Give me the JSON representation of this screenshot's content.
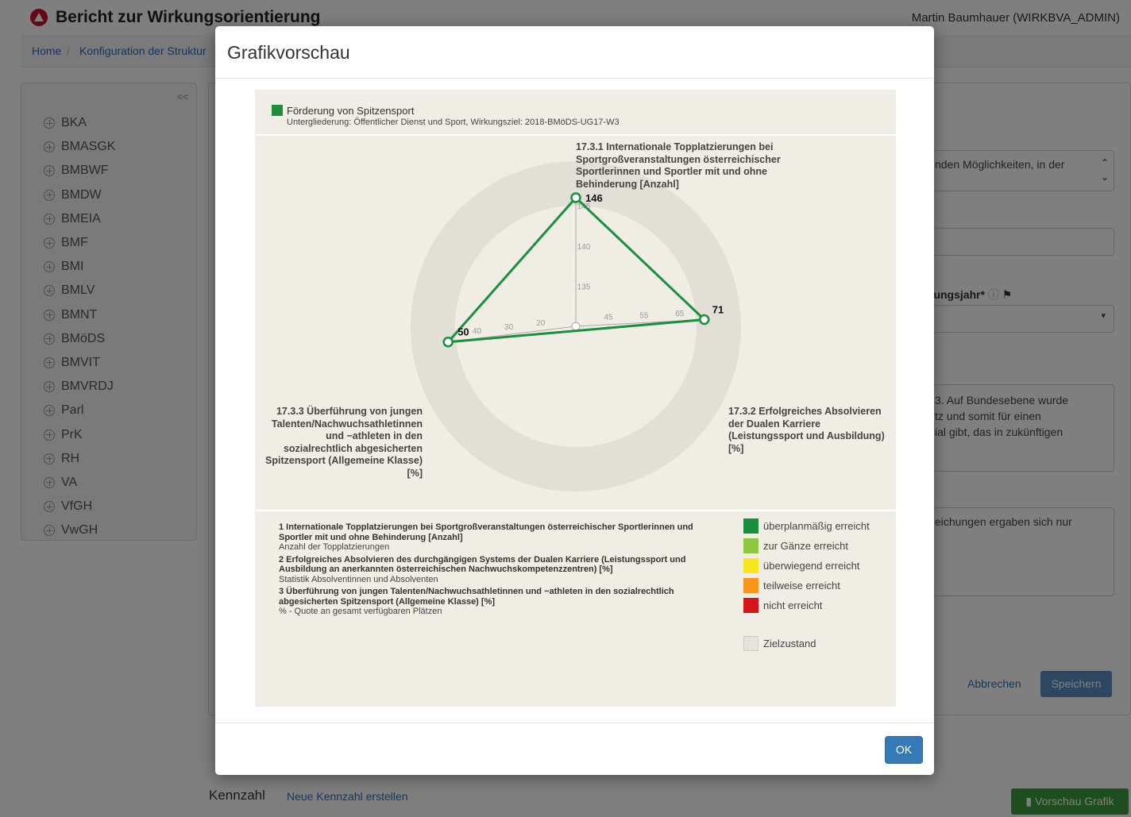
{
  "app": {
    "title": "Bericht zur Wirkungsorientierung",
    "user": "Martin Baumhauer (WIRKBVA_ADMIN)"
  },
  "breadcrumb": {
    "home": "Home",
    "separator": "/",
    "current": "Konfiguration der Struktur"
  },
  "sidebar": {
    "collapse": "<<",
    "items": [
      "BKA",
      "BMASGK",
      "BMBWF",
      "BMDW",
      "BMEIA",
      "BMF",
      "BMI",
      "BMLV",
      "BMNT",
      "BMöDS",
      "BMVIT",
      "BMVRDJ",
      "Parl",
      "PrK",
      "RH",
      "VA",
      "VfGH",
      "VwGH"
    ]
  },
  "background": {
    "text1": "nden Möglichkeiten, in der",
    "label1": "rungsjahr*",
    "text2a": "3. Auf Bundesebene wurde",
    "text2b": "tz und somit für einen",
    "text2c": "ial gibt, das in zukünftigen",
    "text3": "eichungen ergaben sich nur",
    "cancel": "Abbrechen",
    "save": "Speichern",
    "kennzahl": "Kennzahl",
    "new_kennzahl": "Neue Kennzahl erstellen",
    "preview": "Vorschau Grafik"
  },
  "modal": {
    "title": "Grafikvorschau",
    "ok": "OK"
  },
  "chart_data": {
    "type": "radar",
    "title": "Förderung von Spitzensport",
    "subtitle": "Untergliederung: Öffentlicher Dienst und Sport, Wirkungsziel: 2018-BMöDS-UG17-W3",
    "series": [
      {
        "name": "Förderung von Spitzensport",
        "color": "#1a8f3c",
        "values": [
          146,
          71,
          50
        ]
      }
    ],
    "value_labels": [
      "146",
      "71",
      "50"
    ],
    "axes": [
      {
        "label": "17.3.1 Internationale Topplatzierungen bei Sportgroßveranstaltungen österreichischer Sportlerinnen und Sportler mit und ohne Behinderung [Anzahl]",
        "min": 130,
        "max": 146,
        "ticks": [
          "135",
          "140",
          "145"
        ]
      },
      {
        "label": "17.3.2 Erfolgreiches Absolvieren der Dualen Karriere (Leistungssport und Ausbildung) [%]",
        "min": 35,
        "max": 71,
        "ticks": [
          "45",
          "55",
          "65"
        ]
      },
      {
        "label": "17.3.3 Überführung von jungen Talenten/Nachwuchsathletinnen und −athleten in den sozialrechtlich abgesicherten Spitzensport (Allgemeine Klasse) [%]",
        "min": 10,
        "max": 50,
        "ticks": [
          "20",
          "30",
          "40"
        ]
      }
    ],
    "indicator_list": [
      {
        "title": "1 Internationale Topplatzierungen bei Sportgroßveranstaltungen österreichischer Sportlerinnen und Sportler mit und ohne Behinderung [Anzahl]",
        "note": "Anzahl der Topplatzierungen"
      },
      {
        "title": "2 Erfolgreiches Absolvieren des durchgängigen Systems der Dualen Karriere (Leistungssport und Ausbildung an anerkannten österreichischen Nachwuchskompetenzzentren) [%]",
        "note": "Statistik Absolventinnen und Absolventen"
      },
      {
        "title": "3 Überführung von jungen Talenten/Nachwuchsathletinnen und −athleten in den sozialrechtlich abgesicherten Spitzensport (Allgemeine Klasse) [%]",
        "note": "% - Quote an gesamt verfügbaren Plätzen"
      }
    ],
    "status_legend": [
      {
        "label": "überplanmäßig erreicht",
        "color": "#1a8f3c"
      },
      {
        "label": "zur Gänze erreicht",
        "color": "#8dc63f"
      },
      {
        "label": "überwiegend erreicht",
        "color": "#f7e51e"
      },
      {
        "label": "teilweise erreicht",
        "color": "#f7941d"
      },
      {
        "label": "nicht erreicht",
        "color": "#d7141a"
      },
      {
        "label": "Zielzustand",
        "color": "#e5e3da"
      }
    ]
  }
}
